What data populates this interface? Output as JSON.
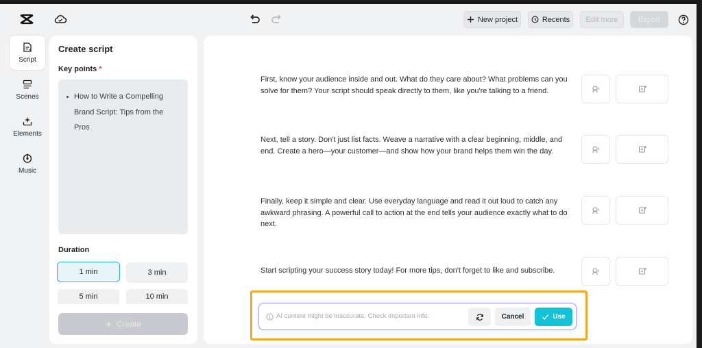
{
  "toolbar": {
    "new_project": "New project",
    "recents": "Recents",
    "edit_more": "Edit more",
    "export": "Export"
  },
  "rail": {
    "items": [
      {
        "label": "Script",
        "icon": "script-icon"
      },
      {
        "label": "Scenes",
        "icon": "scenes-icon"
      },
      {
        "label": "Elements",
        "icon": "elements-icon"
      },
      {
        "label": "Music",
        "icon": "music-icon"
      }
    ]
  },
  "panel": {
    "title": "Create script",
    "key_points_label": "Key points",
    "required_mark": "*",
    "key_points": [
      "How to Write a Compelling Brand Script: Tips from the Pros"
    ],
    "duration_label": "Duration",
    "durations": [
      "1 min",
      "3 min",
      "5 min",
      "10 min"
    ],
    "selected_duration": "1 min",
    "create_label": "Create"
  },
  "script": {
    "paragraphs": [
      "First, know your audience inside and out. What do they care about? What problems can you solve for them? Your script should speak directly to them, like you're talking to a friend.",
      "Next, tell a story. Don't just list facts. Weave a narrative with a clear beginning, middle, and end. Create a hero—your customer—and show how your brand helps them win the day.",
      "Finally, keep it simple and clear. Use everyday language and read it out loud to catch any awkward phrasing. A powerful call to action at the end tells your audience exactly what to do next.",
      "Start scripting your success story today! For more tips, don't forget to like and subscribe."
    ]
  },
  "ai_bar": {
    "notice": "AI content might be inaccurate. Check important info.",
    "cancel": "Cancel",
    "use": "Use"
  },
  "colors": {
    "accent": "#13c2d6",
    "highlight": "#f5a623",
    "ai_border": "#a49cf7"
  }
}
